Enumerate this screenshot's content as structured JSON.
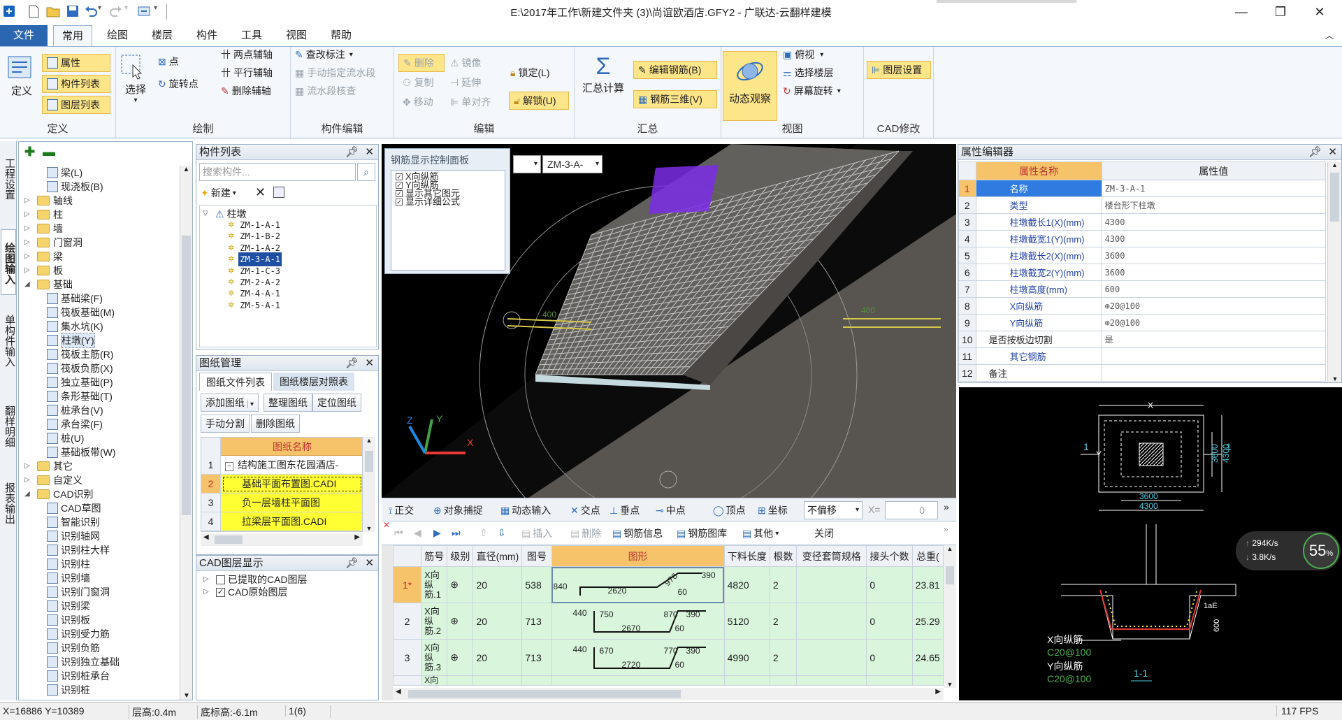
{
  "window": {
    "title": "E:\\2017年工作\\新建文件夹 (3)\\尚谊欧酒店.GFY2 - 广联达-云翻样建模",
    "minimize": "—",
    "maximize": "❐",
    "close": "✕"
  },
  "menu": {
    "file": "文件",
    "tabs": [
      "常用",
      "绘图",
      "楼层",
      "构件",
      "工具",
      "视图",
      "帮助"
    ]
  },
  "ribbon": {
    "define": {
      "name": "定义",
      "big": "定义",
      "items": [
        "属性",
        "构件列表",
        "图层列表"
      ]
    },
    "draw": {
      "name": "绘制",
      "select": "选择",
      "point": "点",
      "rotate_point": "旋转点",
      "axis": [
        "两点辅轴",
        "平行辅轴",
        "删除辅轴"
      ]
    },
    "edit_comp": {
      "name": "构件编辑",
      "items": [
        "查改标注",
        "手动指定流水段",
        "流水段核查"
      ]
    },
    "edit": {
      "name": "编辑",
      "items": [
        "删除",
        "复制",
        "移动",
        "镜像",
        "延伸",
        "单对齐"
      ],
      "lock": "锁定(L)",
      "unlock": "解锁(U)"
    },
    "summary": {
      "name": "汇总",
      "calc": "汇总计算",
      "edit_rebar": "编辑钢筋(B)",
      "rebar_3d": "钢筋三维(V)"
    },
    "view": {
      "name": "视图",
      "dynamic": "动态观察",
      "top": "俯视",
      "floor": "选择楼层",
      "rotate": "屏幕旋转"
    },
    "cad": {
      "name": "CAD修改",
      "layer": "图层设置"
    }
  },
  "side_tabs": [
    "工程设置",
    "绘图输入",
    "单构件输入",
    "翻样明细",
    "报表输出"
  ],
  "nav_tree": {
    "items": [
      {
        "label": "梁(L)",
        "level": 2,
        "type": "comp"
      },
      {
        "label": "现浇板(B)",
        "level": 2,
        "type": "comp"
      },
      {
        "label": "轴线",
        "level": 1,
        "type": "folder"
      },
      {
        "label": "柱",
        "level": 1,
        "type": "folder"
      },
      {
        "label": "墙",
        "level": 1,
        "type": "folder"
      },
      {
        "label": "门窗洞",
        "level": 1,
        "type": "folder"
      },
      {
        "label": "梁",
        "level": 1,
        "type": "folder"
      },
      {
        "label": "板",
        "level": 1,
        "type": "folder"
      },
      {
        "label": "基础",
        "level": 1,
        "type": "folder",
        "open": true
      },
      {
        "label": "基础梁(F)",
        "level": 2,
        "type": "comp"
      },
      {
        "label": "筏板基础(M)",
        "level": 2,
        "type": "comp"
      },
      {
        "label": "集水坑(K)",
        "level": 2,
        "type": "comp"
      },
      {
        "label": "柱墩(Y)",
        "level": 2,
        "type": "comp",
        "selected": true
      },
      {
        "label": "筏板主筋(R)",
        "level": 2,
        "type": "comp"
      },
      {
        "label": "筏板负筋(X)",
        "level": 2,
        "type": "comp"
      },
      {
        "label": "独立基础(P)",
        "level": 2,
        "type": "comp"
      },
      {
        "label": "条形基础(T)",
        "level": 2,
        "type": "comp"
      },
      {
        "label": "桩承台(V)",
        "level": 2,
        "type": "comp"
      },
      {
        "label": "承台梁(F)",
        "level": 2,
        "type": "comp"
      },
      {
        "label": "桩(U)",
        "level": 2,
        "type": "comp"
      },
      {
        "label": "基础板带(W)",
        "level": 2,
        "type": "comp"
      },
      {
        "label": "其它",
        "level": 1,
        "type": "folder"
      },
      {
        "label": "自定义",
        "level": 1,
        "type": "folder"
      },
      {
        "label": "CAD识别",
        "level": 1,
        "type": "folder",
        "open": true
      },
      {
        "label": "CAD草图",
        "level": 2,
        "type": "comp"
      },
      {
        "label": "智能识别",
        "level": 2,
        "type": "comp"
      },
      {
        "label": "识别轴网",
        "level": 2,
        "type": "comp"
      },
      {
        "label": "识别柱大样",
        "level": 2,
        "type": "comp"
      },
      {
        "label": "识别柱",
        "level": 2,
        "type": "comp"
      },
      {
        "label": "识别墙",
        "level": 2,
        "type": "comp"
      },
      {
        "label": "识别门窗洞",
        "level": 2,
        "type": "comp"
      },
      {
        "label": "识别梁",
        "level": 2,
        "type": "comp"
      },
      {
        "label": "识别板",
        "level": 2,
        "type": "comp"
      },
      {
        "label": "识别受力筋",
        "level": 2,
        "type": "comp"
      },
      {
        "label": "识别负筋",
        "level": 2,
        "type": "comp"
      },
      {
        "label": "识别独立基础",
        "level": 2,
        "type": "comp"
      },
      {
        "label": "识别桩承台",
        "level": 2,
        "type": "comp"
      },
      {
        "label": "识别桩",
        "level": 2,
        "type": "comp"
      }
    ]
  },
  "comp_list": {
    "title": "构件列表",
    "search_placeholder": "搜索构件...",
    "new": "新建",
    "root": "柱墩",
    "items": [
      "ZM-1-A-1",
      "ZM-1-B-2",
      "ZM-1-A-2",
      "ZM-3-A-1",
      "ZM-1-C-3",
      "ZM-2-A-2",
      "ZM-4-A-1",
      "ZM-5-A-1"
    ],
    "selected_index": 3
  },
  "drawing_mgr": {
    "title": "图纸管理",
    "tabs": [
      "图纸文件列表",
      "图纸楼层对照表"
    ],
    "buttons": [
      "添加图纸",
      "整理图纸",
      "定位图纸",
      "手动分割",
      "删除图纸"
    ],
    "col": "图纸名称",
    "rows": [
      {
        "n": "1",
        "name": "结构施工图东花园酒店-"
      },
      {
        "n": "2",
        "name": "基础平面布置图.CADI"
      },
      {
        "n": "3",
        "name": "负一层墙柱平面图"
      },
      {
        "n": "4",
        "name": "拉梁层平面图.CADI"
      }
    ]
  },
  "cad_layers": {
    "title": "CAD图层显示",
    "items": [
      "已提取的CAD图层",
      "CAD原始图层"
    ]
  },
  "rebar_panel": {
    "title": "钢筋显示控制面板",
    "items": [
      "X向纵筋",
      "Y向纵筋",
      "显示其它图元",
      "显示详细公式"
    ],
    "combo_value": "ZM-3-A-"
  },
  "viewport": {
    "axis_x": "X",
    "axis_y": "Y",
    "axis_z": "Z",
    "label_left": "400",
    "label_right": "400"
  },
  "snap_toolbar": {
    "items": [
      "正交",
      "对象捕捉",
      "动态输入",
      "交点",
      "垂点",
      "中点",
      "顶点",
      "坐标"
    ],
    "offset": "不偏移",
    "x_label": "X=",
    "x_value": "0"
  },
  "rebar_toolbar": {
    "items": [
      "插入",
      "删除",
      "钢筋信息",
      "钢筋图库",
      "其他",
      "关闭"
    ]
  },
  "rebar_table": {
    "headers": [
      "筋号",
      "级别",
      "直径(mm)",
      "图号",
      "图形",
      "下料长度",
      "根数",
      "变径套筒规格",
      "接头个数",
      "总重("
    ],
    "rows": [
      {
        "n": "1*",
        "name": "X向纵筋.1",
        "grade": "⊕",
        "dia": "20",
        "fig": "538",
        "a": "840",
        "b": "2620",
        "c": "970",
        "d": "390",
        "e": "60",
        "len": "4820",
        "count": "2",
        "sleeve": "",
        "joints": "0",
        "weight": "23.81"
      },
      {
        "n": "2",
        "name": "X向纵筋.2",
        "grade": "⊕",
        "dia": "20",
        "fig": "713",
        "a": "440",
        "a2": "750",
        "b": "2670",
        "c": "870",
        "d": "390",
        "e": "60",
        "len": "5120",
        "count": "2",
        "sleeve": "",
        "joints": "0",
        "weight": "25.29"
      },
      {
        "n": "3",
        "name": "X向纵筋.3",
        "grade": "⊕",
        "dia": "20",
        "fig": "713",
        "a": "440",
        "a2": "670",
        "b": "2720",
        "c": "770",
        "d": "390",
        "e": "60",
        "len": "4990",
        "count": "2",
        "sleeve": "",
        "joints": "0",
        "weight": "24.65"
      }
    ],
    "row4_name": "X向"
  },
  "props": {
    "title": "属性编辑器",
    "col_name": "属性名称",
    "col_value": "属性值",
    "rows": [
      {
        "n": "1",
        "name": "名称",
        "value": "ZM-3-A-1"
      },
      {
        "n": "2",
        "name": "类型",
        "value": "楼台形下柱墩"
      },
      {
        "n": "3",
        "name": "柱墩截长1(X)(mm)",
        "value": "4300"
      },
      {
        "n": "4",
        "name": "柱墩截宽1(Y)(mm)",
        "value": "4300"
      },
      {
        "n": "5",
        "name": "柱墩截长2(X)(mm)",
        "value": "3600"
      },
      {
        "n": "6",
        "name": "柱墩截宽2(Y)(mm)",
        "value": "3600"
      },
      {
        "n": "7",
        "name": "柱墩高度(mm)",
        "value": "600"
      },
      {
        "n": "8",
        "name": "X向纵筋",
        "value": "⊕20@100"
      },
      {
        "n": "9",
        "name": "Y向纵筋",
        "value": "⊕20@100"
      },
      {
        "n": "10",
        "name": "是否按板边切割",
        "value": "是"
      },
      {
        "n": "11",
        "name": "其它钢筋",
        "value": ""
      },
      {
        "n": "12",
        "name": "备注",
        "value": ""
      }
    ]
  },
  "preview": {
    "x": "X",
    "y": "Y",
    "dim_3600": "3600",
    "dim_4300": "4300",
    "label_1": "1",
    "label_1e": "1aE",
    "dim_600": "600",
    "xbar": "X向纵筋",
    "xbar_spec": "C20@100",
    "ybar": "Y向纵筋",
    "ybar_spec": "C20@100",
    "section": "1-1",
    "net_up": "294K/s",
    "net_down": "3.8K/s",
    "cpu": "55",
    "cpu_unit": "%"
  },
  "status": {
    "coords": "X=16886 Y=10389",
    "floor_h": "层高:0.4m",
    "base": "底标高:-6.1m",
    "count": "1(6)",
    "fps": "117 FPS"
  }
}
